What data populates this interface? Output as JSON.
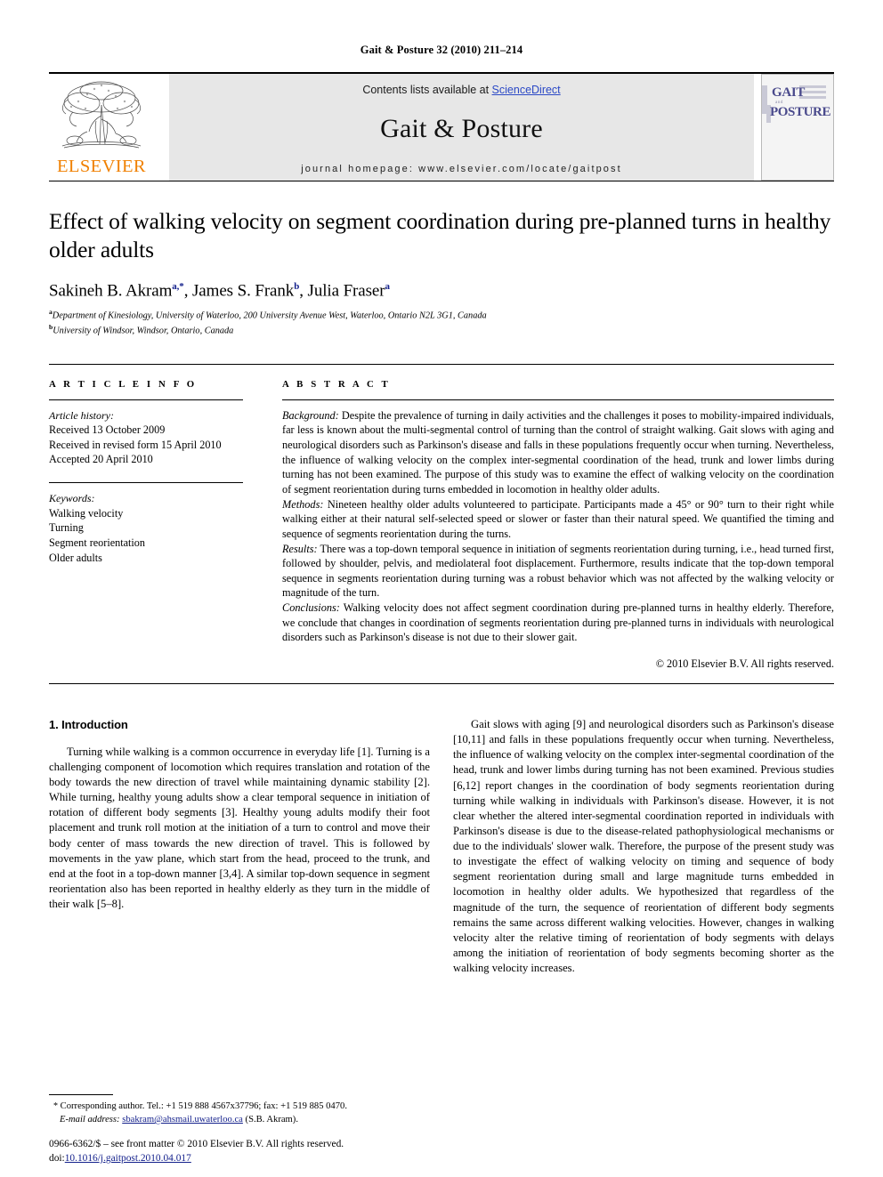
{
  "running_head": "Gait & Posture 32 (2010) 211–214",
  "masthead": {
    "publisher_name": "ELSEVIER",
    "contents_prefix": "Contents lists available at ",
    "sciencedirect": "ScienceDirect",
    "journal_name": "Gait & Posture",
    "homepage": "journal homepage: www.elsevier.com/locate/gaitpost",
    "cover": {
      "line1": "GAIT",
      "line2": "and",
      "line3": "POSTURE"
    },
    "accent_color": "#2b49c6",
    "elsevier_color": "#F08000",
    "cover_text_color": "#4a4a8c"
  },
  "title": "Effect of walking velocity on segment coordination during pre-planned turns in healthy older adults",
  "authors": [
    {
      "name": "Sakineh B. Akram",
      "sup": "a,*"
    },
    {
      "name": "James S. Frank",
      "sup": "b"
    },
    {
      "name": "Julia Fraser",
      "sup": "a"
    }
  ],
  "authors_line": "Sakineh B. Akram a,*, James S. Frank b, Julia Fraser a",
  "affiliations": [
    {
      "marker": "a",
      "text": "Department of Kinesiology, University of Waterloo, 200 University Avenue West, Waterloo, Ontario N2L 3G1, Canada"
    },
    {
      "marker": "b",
      "text": "University of Windsor, Windsor, Ontario, Canada"
    }
  ],
  "article_info": {
    "heading": "A R T I C L E  I N F O",
    "history_label": "Article history:",
    "history": [
      "Received 13 October 2009",
      "Received in revised form 15 April 2010",
      "Accepted 20 April 2010"
    ],
    "keywords_label": "Keywords:",
    "keywords": [
      "Walking velocity",
      "Turning",
      "Segment reorientation",
      "Older adults"
    ]
  },
  "abstract": {
    "heading": "A B S T R A C T",
    "sections": [
      {
        "label": "Background:",
        "text": " Despite the prevalence of turning in daily activities and the challenges it poses to mobility-impaired individuals, far less is known about the multi-segmental control of turning than the control of straight walking. Gait slows with aging and neurological disorders such as Parkinson's disease and falls in these populations frequently occur when turning. Nevertheless, the influence of walking velocity on the complex inter-segmental coordination of the head, trunk and lower limbs during turning has not been examined. The purpose of this study was to examine the effect of walking velocity on the coordination of segment reorientation during turns embedded in locomotion in healthy older adults."
      },
      {
        "label": "Methods:",
        "text": " Nineteen healthy older adults volunteered to participate. Participants made a 45° or 90° turn to their right while walking either at their natural self-selected speed or slower or faster than their natural speed. We quantified the timing and sequence of segments reorientation during the turns."
      },
      {
        "label": "Results:",
        "text": " There was a top-down temporal sequence in initiation of segments reorientation during turning, i.e., head turned first, followed by shoulder, pelvis, and mediolateral foot displacement. Furthermore, results indicate that the top-down temporal sequence in segments reorientation during turning was a robust behavior which was not affected by the walking velocity or magnitude of the turn."
      },
      {
        "label": "Conclusions:",
        "text": " Walking velocity does not affect segment coordination during pre-planned turns in healthy elderly. Therefore, we conclude that changes in coordination of segments reorientation during pre-planned turns in individuals with neurological disorders such as Parkinson's disease is not due to their slower gait."
      }
    ],
    "copyright": "© 2010 Elsevier B.V. All rights reserved."
  },
  "introduction": {
    "heading": "1. Introduction",
    "left_paragraph": "Turning while walking is a common occurrence in everyday life [1]. Turning is a challenging component of locomotion which requires translation and rotation of the body towards the new direction of travel while maintaining dynamic stability [2]. While turning, healthy young adults show a clear temporal sequence in initiation of rotation of different body segments [3]. Healthy young adults modify their foot placement and trunk roll motion at the initiation of a turn to control and move their body center of mass towards the new direction of travel. This is followed by movements in the yaw plane, which start from the head, proceed to the trunk, and end at the foot in a top-down manner [3,4]. A similar top-down sequence in segment reorientation also has been reported in healthy elderly as they turn in the middle of their walk [5–8].",
    "right_paragraph": "Gait slows with aging [9] and neurological disorders such as Parkinson's disease [10,11] and falls in these populations frequently occur when turning. Nevertheless, the influence of walking velocity on the complex inter-segmental coordination of the head, trunk and lower limbs during turning has not been examined. Previous studies [6,12] report changes in the coordination of body segments reorientation during turning while walking in individuals with Parkinson's disease. However, it is not clear whether the altered inter-segmental coordination reported in individuals with Parkinson's disease is due to the disease-related pathophysiological mechanisms or due to the individuals' slower walk. Therefore, the purpose of the present study was to investigate the effect of walking velocity on timing and sequence of body segment reorientation during small and large magnitude turns embedded in locomotion in healthy older adults. We hypothesized that regardless of the magnitude of the turn, the sequence of reorientation of different body segments remains the same across different walking velocities. However, changes in walking velocity alter the relative timing of reorientation of body segments with delays among the initiation of reorientation of body segments becoming shorter as the walking velocity increases."
  },
  "footnote": {
    "star": "*",
    "corresponding": " Corresponding author. Tel.: +1 519 888 4567x37796; fax: +1 519 885 0470.",
    "email_label": "E-mail address:",
    "email": "sbakram@ahsmail.uwaterloo.ca",
    "email_owner": " (S.B. Akram)."
  },
  "imprint": {
    "line1": "0966-6362/$ – see front matter © 2010 Elsevier B.V. All rights reserved.",
    "doi_label": "doi:",
    "doi": "10.1016/j.gaitpost.2010.04.017"
  }
}
